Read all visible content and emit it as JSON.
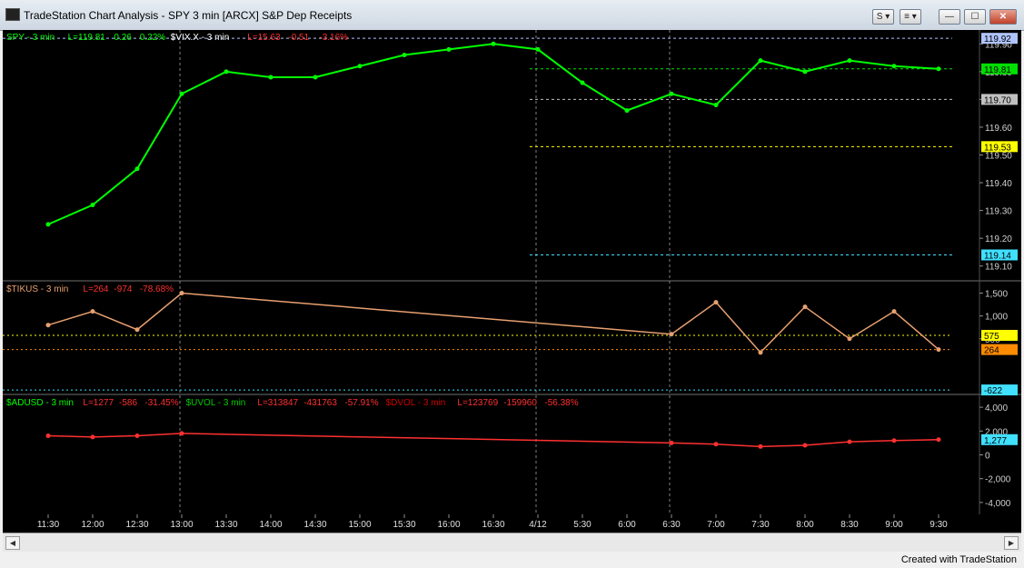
{
  "window": {
    "title": "TradeStation Chart Analysis - SPY 3 min [ARCX] S&P Dep Receipts",
    "buttons": {
      "s_label": "S",
      "list_label": "≡",
      "minimize": "—",
      "maximize": "☐",
      "close": "✕"
    }
  },
  "footer": "Created with TradeStation",
  "colors": {
    "background": "#000000",
    "price_line": "#00ff00",
    "vix": "#ffffff",
    "tikus": "#e8a070",
    "adusd": "#ff3030",
    "uvol": "#00cc00",
    "dvol": "#cc0000"
  },
  "panes": [
    {
      "legend": [
        {
          "text": "SPY - 3 min",
          "color": "#00ff00"
        },
        {
          "text": "L=119.81",
          "color": "#00ff00"
        },
        {
          "text": "0.26",
          "color": "#00ff00"
        },
        {
          "text": "0.22%",
          "color": "#00ff00"
        },
        {
          "text": "$VIX.X - 3 min",
          "color": "#ffffff"
        },
        {
          "text": "L=15.63",
          "color": "#ff3030"
        },
        {
          "text": "-0.51",
          "color": "#ff3030"
        },
        {
          "text": "-3.16%",
          "color": "#ff3030"
        }
      ],
      "y_ticks": [
        "119.10",
        "119.20",
        "119.30",
        "119.40",
        "119.50",
        "119.60",
        "119.70",
        "119.80",
        "119.90"
      ],
      "tags": [
        {
          "text": "119.92",
          "bg": "#b0c4ff",
          "fg": "#000000"
        },
        {
          "text": "119.81",
          "bg": "#00e000",
          "fg": "#000000"
        },
        {
          "text": "119.70",
          "bg": "#c0c0c0",
          "fg": "#000000"
        },
        {
          "text": "119.53",
          "bg": "#ffff00",
          "fg": "#000000"
        },
        {
          "text": "119.14",
          "bg": "#40e0ff",
          "fg": "#000000"
        }
      ]
    },
    {
      "legend": [
        {
          "text": "$TIKUS - 3 min",
          "color": "#e8a070"
        },
        {
          "text": "L=264",
          "color": "#ff3030"
        },
        {
          "text": "-974",
          "color": "#ff3030"
        },
        {
          "text": "-78.68%",
          "color": "#ff3030"
        }
      ],
      "y_ticks": [
        "1,500",
        "1,000",
        "500"
      ],
      "tags": [
        {
          "text": "575",
          "bg": "#ffff00",
          "fg": "#000000"
        },
        {
          "text": "264",
          "bg": "#ff8c00",
          "fg": "#000000"
        },
        {
          "text": "-622",
          "bg": "#40e0ff",
          "fg": "#000000"
        }
      ]
    },
    {
      "legend": [
        {
          "text": "$ADUSD - 3 min",
          "color": "#00ff00"
        },
        {
          "text": "L=1277",
          "color": "#ff3030"
        },
        {
          "text": "-586",
          "color": "#ff3030"
        },
        {
          "text": "-31.45%",
          "color": "#ff3030"
        },
        {
          "text": "$UVOL - 3 min",
          "color": "#00cc00"
        },
        {
          "text": "L=313847",
          "color": "#ff3030"
        },
        {
          "text": "-431763",
          "color": "#ff3030"
        },
        {
          "text": "-57.91%",
          "color": "#ff3030"
        },
        {
          "text": "$DVOL - 3 min",
          "color": "#cc0000"
        },
        {
          "text": "L=123769",
          "color": "#ff3030"
        },
        {
          "text": "-159960",
          "color": "#ff3030"
        },
        {
          "text": "-56.38%",
          "color": "#ff3030"
        }
      ],
      "y_ticks": [
        "4,000",
        "2,000",
        "0",
        "-2,000",
        "-4,000"
      ],
      "tags": [
        {
          "text": "1,277",
          "bg": "#40e0ff",
          "fg": "#000000"
        }
      ]
    }
  ],
  "chart_data": {
    "type": "line",
    "x_tick_labels": [
      "11:30",
      "12:00",
      "12:30",
      "13:00",
      "13:30",
      "14:00",
      "14:30",
      "15:00",
      "15:30",
      "16:00",
      "16:30",
      "4/12",
      "5:30",
      "6:00",
      "6:30",
      "7:00",
      "7:30",
      "8:00",
      "8:30",
      "9:00",
      "9:30"
    ],
    "series": [
      {
        "name": "SPY - 3 min",
        "x": [
          "11:30",
          "12:00",
          "12:30",
          "13:00",
          "13:30",
          "14:00",
          "14:30",
          "15:00",
          "15:30",
          "16:00",
          "16:30",
          "4/12",
          "5:30",
          "6:00",
          "6:30",
          "7:00",
          "7:30",
          "8:00",
          "8:30",
          "9:00",
          "9:30"
        ],
        "y": [
          119.25,
          119.32,
          119.45,
          119.72,
          119.8,
          119.78,
          119.78,
          119.82,
          119.86,
          119.88,
          119.9,
          119.88,
          119.76,
          119.66,
          119.72,
          119.68,
          119.84,
          119.8,
          119.84,
          119.82,
          119.81
        ]
      },
      {
        "name": "$TIKUS - 3 min",
        "x": [
          "11:30",
          "12:00",
          "12:30",
          "13:00",
          "6:30",
          "7:00",
          "7:30",
          "8:00",
          "8:30",
          "9:00",
          "9:30"
        ],
        "y": [
          800,
          1100,
          700,
          1500,
          600,
          1300,
          200,
          1200,
          500,
          1100,
          264
        ]
      },
      {
        "name": "$ADUSD - 3 min",
        "x": [
          "11:30",
          "12:00",
          "12:30",
          "13:00",
          "6:30",
          "7:00",
          "7:30",
          "8:00",
          "8:30",
          "9:00",
          "9:30"
        ],
        "y": [
          1600,
          1500,
          1600,
          1800,
          1000,
          900,
          700,
          800,
          1100,
          1200,
          1277
        ]
      }
    ],
    "levels": [
      119.92,
      119.81,
      119.7,
      119.53,
      119.14
    ],
    "tikus_levels": [
      575,
      264,
      -622
    ]
  }
}
